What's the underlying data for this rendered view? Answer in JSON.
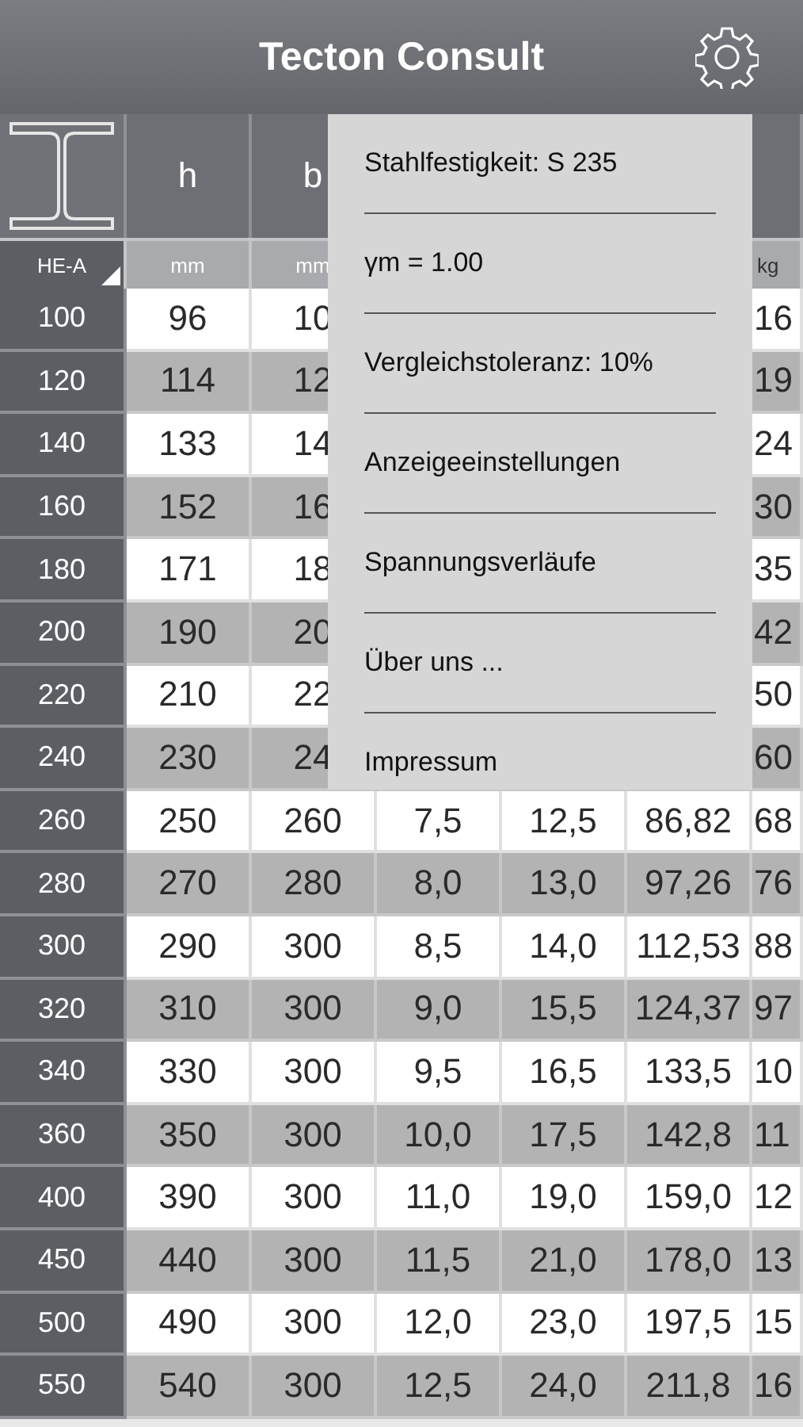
{
  "title": "Tecton Consult",
  "header": {
    "profile": "HE-A",
    "h": "h",
    "b": "b",
    "units": {
      "h": "mm",
      "b": "mm",
      "column_7": "kg"
    }
  },
  "rows": [
    {
      "designation": "100",
      "h": "96",
      "b": "10",
      "column_7": "16"
    },
    {
      "designation": "120",
      "h": "114",
      "b": "12",
      "column_7": "19"
    },
    {
      "designation": "140",
      "h": "133",
      "b": "14",
      "column_7": "24"
    },
    {
      "designation": "160",
      "h": "152",
      "b": "16",
      "column_7": "30"
    },
    {
      "designation": "180",
      "h": "171",
      "b": "18",
      "column_7": "35"
    },
    {
      "designation": "200",
      "h": "190",
      "b": "20",
      "column_7": "42"
    },
    {
      "designation": "220",
      "h": "210",
      "b": "22",
      "column_7": "50"
    },
    {
      "designation": "240",
      "h": "230",
      "b": "24",
      "column_7": "60"
    },
    {
      "designation": "260",
      "h": "250",
      "b": "260",
      "tw": "7,5",
      "tf": "12,5",
      "A": "86,82",
      "column_7": "68"
    },
    {
      "designation": "280",
      "h": "270",
      "b": "280",
      "tw": "8,0",
      "tf": "13,0",
      "A": "97,26",
      "column_7": "76"
    },
    {
      "designation": "300",
      "h": "290",
      "b": "300",
      "tw": "8,5",
      "tf": "14,0",
      "A": "112,53",
      "column_7": "88"
    },
    {
      "designation": "320",
      "h": "310",
      "b": "300",
      "tw": "9,0",
      "tf": "15,5",
      "A": "124,37",
      "column_7": "97"
    },
    {
      "designation": "340",
      "h": "330",
      "b": "300",
      "tw": "9,5",
      "tf": "16,5",
      "A": "133,5",
      "column_7": "10"
    },
    {
      "designation": "360",
      "h": "350",
      "b": "300",
      "tw": "10,0",
      "tf": "17,5",
      "A": "142,8",
      "column_7": "11"
    },
    {
      "designation": "400",
      "h": "390",
      "b": "300",
      "tw": "11,0",
      "tf": "19,0",
      "A": "159,0",
      "column_7": "12"
    },
    {
      "designation": "450",
      "h": "440",
      "b": "300",
      "tw": "11,5",
      "tf": "21,0",
      "A": "178,0",
      "column_7": "13"
    },
    {
      "designation": "500",
      "h": "490",
      "b": "300",
      "tw": "12,0",
      "tf": "23,0",
      "A": "197,5",
      "column_7": "15"
    },
    {
      "designation": "550",
      "h": "540",
      "b": "300",
      "tw": "12,5",
      "tf": "24,0",
      "A": "211,8",
      "column_7": "16"
    }
  ],
  "menu": [
    "Stahlfestigkeit: S 235",
    "γm = 1.00",
    "Vergleichstoleranz: 10%",
    "Anzeigeeinstellungen",
    "Spannungsverläufe",
    "Über uns ...",
    "Impressum"
  ]
}
